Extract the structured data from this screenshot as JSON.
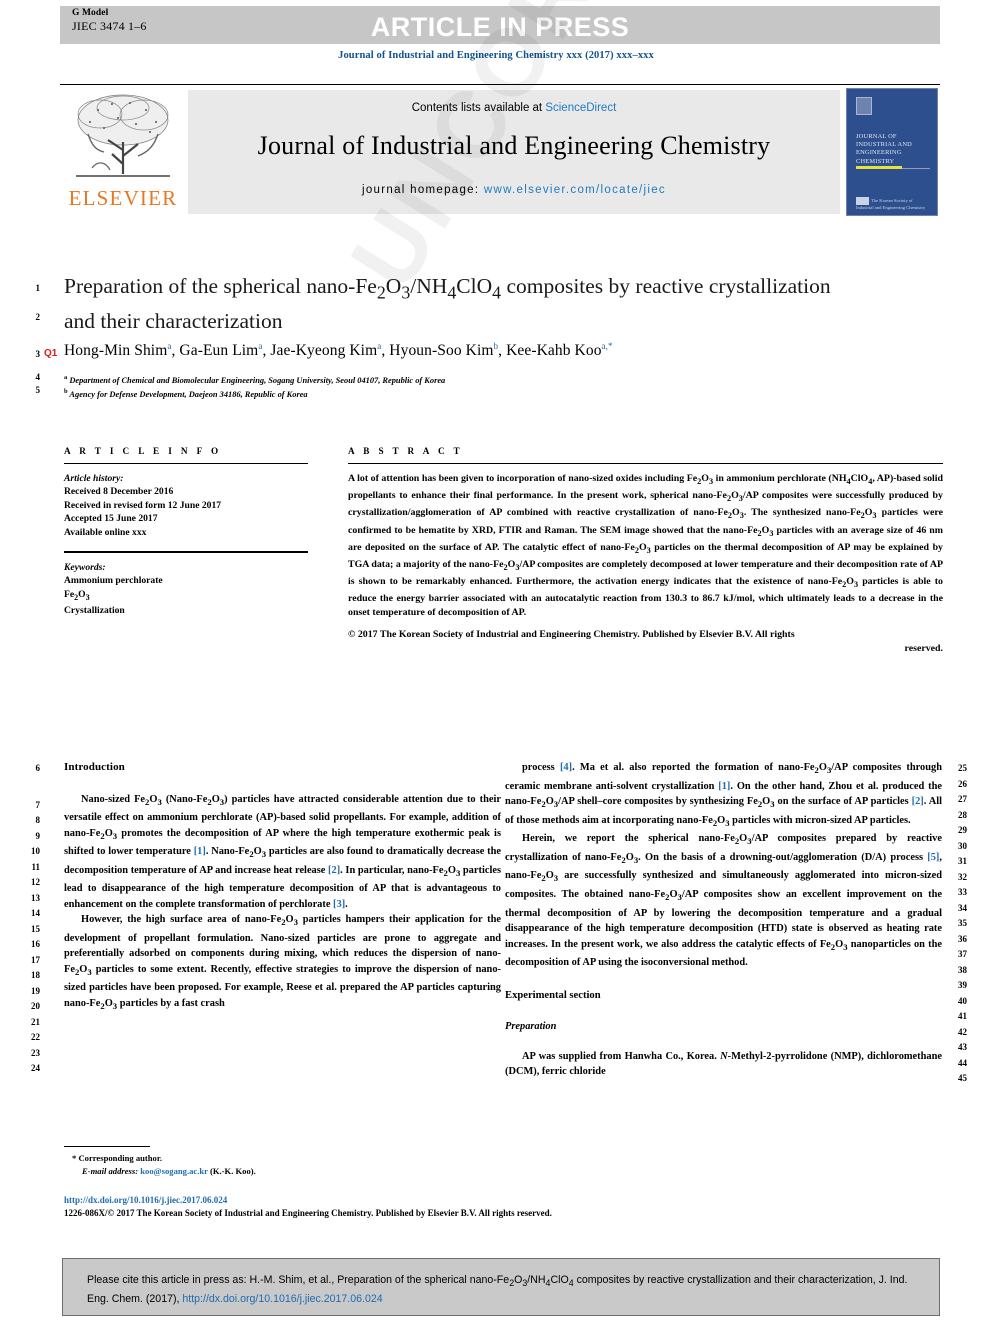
{
  "header": {
    "g_model_label": "G Model",
    "g_model_code": "JIEC 3474 1–6",
    "article_in_press": "ARTICLE IN PRESS",
    "journal_ref": "Journal of Industrial and Engineering Chemistry xxx (2017) xxx–xxx"
  },
  "masthead": {
    "contents_prefix": "Contents lists available at ",
    "sciencedirect": "ScienceDirect",
    "journal_title": "Journal of Industrial and Engineering Chemistry",
    "homepage_prefix": "journal homepage: ",
    "homepage_url": "www.elsevier.com/locate/jiec",
    "publisher_wordmark": "ELSEVIER",
    "cover_title": "JOURNAL OF INDUSTRIAL AND ENGINEERING CHEMISTRY",
    "cover_footer": "The Korean Society of Industrial and Engineering Chemistry"
  },
  "article": {
    "title": "Preparation of the spherical nano-Fe2O3/NH4ClO4 composites by reactive crystallization and their characterization",
    "title_html": "Preparation of the spherical nano-Fe<sub>2</sub>O<sub>3</sub>/NH<sub>4</sub>ClO<sub>4</sub> composites by reactive crystallization and their characterization",
    "authors_html": "Hong-Min Shim<sup>a</sup>, Ga-Eun Lim<sup>a</sup>, Jae-Kyeong Kim<sup>a</sup>, Hyoun-Soo Kim<sup>b</sup>, Kee-Kahb Koo<sup>a,*</sup>",
    "affiliation_a": "Department of Chemical and Biomolecular Engineering, Sogang University, Seoul 04107, Republic of Korea",
    "affiliation_b": "Agency for Defense Development, Daejeon 34186, Republic of Korea",
    "query_marker": "Q1"
  },
  "article_info": {
    "heading": "A R T I C L E  I N F O",
    "history_label": "Article history:",
    "history": [
      "Received 8 December 2016",
      "Received in revised form 12 June 2017",
      "Accepted 15 June 2017",
      "Available online xxx"
    ],
    "keywords_label": "Keywords:",
    "keywords": [
      "Ammonium perchlorate",
      "Fe2O3",
      "Crystallization"
    ]
  },
  "abstract": {
    "heading": "A B S T R A C T",
    "body_html": "A lot of attention has been given to incorporation of nano-sized oxides including Fe<sub>2</sub>O<sub>3</sub> in ammonium perchlorate (NH<sub>4</sub>ClO<sub>4</sub>, AP)-based solid propellants to enhance their final performance. In the present work, spherical nano-Fe<sub>2</sub>O<sub>3</sub>/AP composites were successfully produced by crystallization/agglomeration of AP combined with reactive crystallization of nano-Fe<sub>2</sub>O<sub>3</sub>. The synthesized nano-Fe<sub>2</sub>O<sub>3</sub> particles were confirmed to be hematite by XRD, FTIR and Raman. The SEM image showed that the nano-Fe<sub>2</sub>O<sub>3</sub> particles with an average size of 46 nm are deposited on the surface of AP. The catalytic effect of nano-Fe<sub>2</sub>O<sub>3</sub> particles on the thermal decomposition of AP may be explained by TGA data; a majority of the nano-Fe<sub>2</sub>O<sub>3</sub>/AP composites are completely decomposed at lower temperature and their decomposition rate of AP is shown to be remarkably enhanced. Furthermore, the activation energy indicates that the existence of nano-Fe<sub>2</sub>O<sub>3</sub> particles is able to reduce the energy barrier associated with an autocatalytic reaction from 130.3 to 86.7 kJ/mol, which ultimately leads to a decrease in the onset temperature of decomposition of AP.",
    "copyright": "© 2017 The Korean Society of Industrial and Engineering Chemistry. Published by Elsevier B.V. All rights",
    "copyright_end": "reserved."
  },
  "body": {
    "intro_heading": "Introduction",
    "left_p1_html": "Nano-sized Fe<sub>2</sub>O<sub>3</sub> (Nano-Fe<sub>2</sub>O<sub>3</sub>) particles have attracted considerable attention due to their versatile effect on ammonium perchlorate (AP)-based solid propellants. For example, addition of nano-Fe<sub>2</sub>O<sub>3</sub> promotes the decomposition of AP where the high temperature exothermic peak is shifted to lower temperature <span class=\"cite\">[1]</span>. Nano-Fe<sub>2</sub>O<sub>3</sub> particles are also found to dramatically decrease the decomposition temperature of AP and increase heat release <span class=\"cite\">[2]</span>. In particular, nano-Fe<sub>2</sub>O<sub>3</sub> particles lead to disappearance of the high temperature decomposition of AP that is advantageous to enhancement on the complete transformation of perchlorate <span class=\"cite\">[3]</span>.",
    "left_p2_html": "However, the high surface area of nano-Fe<sub>2</sub>O<sub>3</sub> particles hampers their application for the development of propellant formulation. Nano-sized particles are prone to aggregate and preferentially adsorbed on components during mixing, which reduces the dispersion of nano-Fe<sub>2</sub>O<sub>3</sub> particles to some extent. Recently, effective strategies to improve the dispersion of nano-sized particles have been proposed. For example, Reese et al. prepared the AP particles capturing nano-Fe<sub>2</sub>O<sub>3</sub> particles by a fast crash",
    "right_p1_html": "process <span class=\"cite\">[4]</span>. Ma et al. also reported the formation of nano-Fe<sub>2</sub>O<sub>3</sub>/AP composites through ceramic membrane anti-solvent crystallization <span class=\"cite\">[1]</span>. On the other hand, Zhou et al. produced the nano-Fe<sub>2</sub>O<sub>3</sub>/AP shell–core composites by synthesizing Fe<sub>2</sub>O<sub>3</sub> on the surface of AP particles <span class=\"cite\">[2]</span>. All of those methods aim at incorporating nano-Fe<sub>2</sub>O<sub>3</sub> particles with micron-sized AP particles.",
    "right_p2_html": "Herein, we report the spherical nano-Fe<sub>2</sub>O<sub>3</sub>/AP composites prepared by reactive crystallization of nano-Fe<sub>2</sub>O<sub>3</sub>. On the basis of a drowning-out/agglomeration (D/A) process <span class=\"cite\">[5]</span>, nano-Fe<sub>2</sub>O<sub>3</sub> are successfully synthesized and simultaneously agglomerated into micron-sized composites. The obtained nano-Fe<sub>2</sub>O<sub>3</sub>/AP composites show an excellent improvement on the thermal decomposition of AP by lowering the decomposition temperature and a gradual disappearance of the high temperature decomposition (HTD) state is observed as heating rate increases. In the present work, we also address the catalytic effects of Fe<sub>2</sub>O<sub>3</sub> nanoparticles on the decomposition of AP using the isoconversional method.",
    "experimental_heading": "Experimental section",
    "preparation_heading": "Preparation",
    "right_p3_html": "AP was supplied from Hanwha Co., Korea. <em>N</em>-Methyl-2-pyrrolidone (NMP), dichloromethane (DCM), ferric chloride"
  },
  "footnote": {
    "corresponding": "Corresponding author.",
    "email_label": "E-mail address:",
    "email": "koo@sogang.ac.kr",
    "email_suffix": "(K.-K. Koo).",
    "doi": "http://dx.doi.org/10.1016/j.jiec.2017.06.024",
    "issn_copyright": "1226-086X/© 2017 The Korean Society of Industrial and Engineering Chemistry. Published by Elsevier B.V. All rights reserved."
  },
  "cite_box": {
    "text_html": "Please cite this article in press as: H.-M. Shim, et al., Preparation of the spherical nano-Fe<sub>2</sub>O<sub>3</sub>/NH<sub>4</sub>ClO<sub>4</sub> composites by reactive crystallization and their characterization, J. Ind. Eng. Chem. (2017), <span class=\"lnk\">http://dx.doi.org/10.1016/j.jiec.2017.06.024</span>"
  },
  "line_numbers": {
    "title_block": [
      "1",
      "2",
      "3",
      "4",
      "5"
    ],
    "left_column": [
      "6",
      "7",
      "8",
      "9",
      "10",
      "11",
      "12",
      "13",
      "14",
      "15",
      "16",
      "17",
      "18",
      "19",
      "20",
      "21",
      "22",
      "23",
      "24"
    ],
    "right_column": [
      "25",
      "26",
      "27",
      "28",
      "29",
      "30",
      "31",
      "32",
      "33",
      "34",
      "35",
      "36",
      "37",
      "38",
      "39",
      "40",
      "41",
      "42",
      "43",
      "44",
      "45"
    ]
  },
  "watermark": {
    "text": "UNCORRECTED PROOF"
  }
}
